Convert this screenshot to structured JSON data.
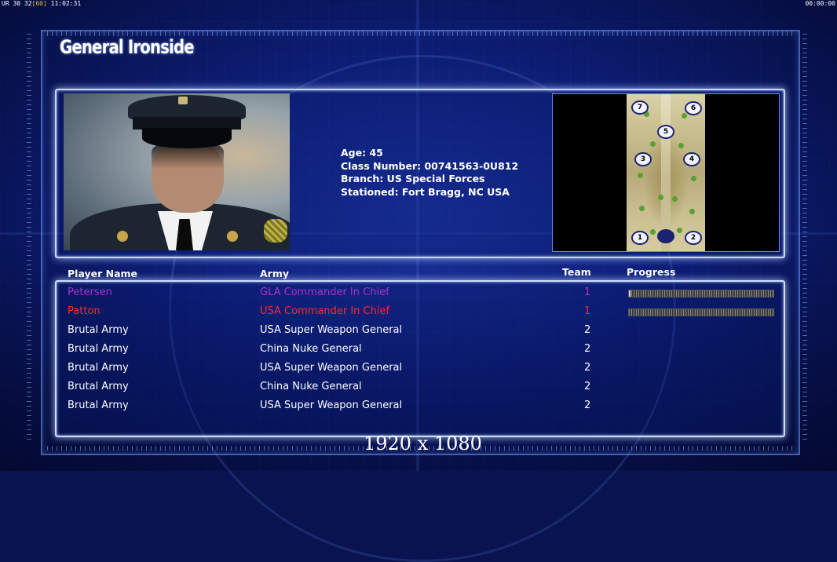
{
  "hud": {
    "top_left_prefix": "UR 30 32",
    "top_left_bracket": "[60]",
    "top_left_time": "11:02:31",
    "top_right_time": "00:00:00"
  },
  "general": {
    "name": "General Ironside",
    "info": [
      "Age: 45",
      "Class Number: 00741563-0U812",
      "Branch: US Special Forces",
      "Stationed: Fort Bragg, NC USA"
    ]
  },
  "minimap": {
    "slots": [
      "1",
      "2",
      "3",
      "4",
      "5",
      "6",
      "7"
    ]
  },
  "table": {
    "headers": {
      "player": "Player Name",
      "army": "Army",
      "team": "Team",
      "progress": "Progress"
    },
    "rows": [
      {
        "name": "Petersen",
        "army": "GLA Commander In Chief",
        "team": "1",
        "color": "#b02fd0",
        "progress": 0.01,
        "show_progress": true
      },
      {
        "name": "Patton",
        "army": "USA Commander In Chief",
        "team": "1",
        "color": "#ff2a2a",
        "progress": 0,
        "show_progress": true
      },
      {
        "name": "Brutal Army",
        "army": "USA Super Weapon General",
        "team": "2",
        "color": "#ffffff",
        "show_progress": false
      },
      {
        "name": "Brutal Army",
        "army": "China Nuke General",
        "team": "2",
        "color": "#ffffff",
        "show_progress": false
      },
      {
        "name": "Brutal Army",
        "army": "USA Super Weapon General",
        "team": "2",
        "color": "#ffffff",
        "show_progress": false
      },
      {
        "name": "Brutal Army",
        "army": "China Nuke General",
        "team": "2",
        "color": "#ffffff",
        "show_progress": false
      },
      {
        "name": "Brutal Army",
        "army": "USA Super Weapon General",
        "team": "2",
        "color": "#ffffff",
        "show_progress": false
      }
    ]
  },
  "resolution_label": "1920 x 1080"
}
